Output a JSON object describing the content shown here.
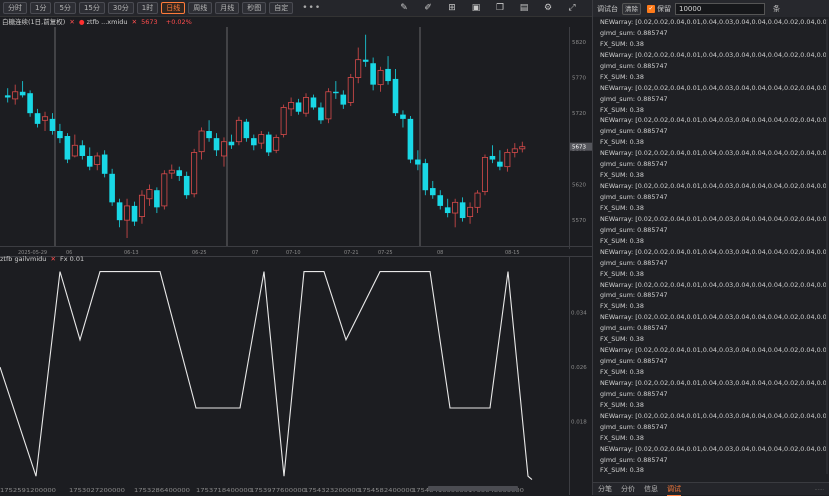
{
  "toolbar": {
    "periods": [
      "分时",
      "1分",
      "5分",
      "15分",
      "30分",
      "1时",
      "日线",
      "周线",
      "月线",
      "秒图",
      "自定"
    ],
    "active_period": "日线",
    "more": "•••",
    "tools": [
      "pencil-icon",
      "edit-icon",
      "layout-icon",
      "window-icon",
      "copy-icon",
      "save-icon",
      "settings-icon",
      "expand-icon"
    ]
  },
  "chart": {
    "legend_name": "白糖连续(1日,前复权)",
    "legend_indicator": "ztfb",
    "legend_source": "...xmidu",
    "legend_value": "5673",
    "legend_change": "+0.02%",
    "sub_title": "ztfb gailvmidu",
    "sub_indicator": "Fx 0.01",
    "price_ticks": [
      "5820",
      "5770",
      "5720",
      "5670",
      "5620",
      "5570"
    ],
    "current_price": "5673",
    "date_ticks": [
      "2025-05-29",
      "06",
      "06-13",
      "06-25",
      "07",
      "07-10",
      "07-21",
      "07-25",
      "08",
      "08-15"
    ],
    "indicator_ticks": [
      "0.034",
      "0.026",
      "0.018"
    ],
    "bottom_ticks": [
      "1752591200000",
      "1753027200000",
      "1753286400000",
      "1753718400000",
      "1753977600000",
      "1754323200000",
      "1754582400000",
      "1754841600000",
      "1755048000000"
    ],
    "up_color": "#d94b4b",
    "down_color": "#19d8e6"
  },
  "chart_data": {
    "type": "candlestick",
    "ylim": [
      5538,
      5838
    ],
    "candles": [
      {
        "o": 5745,
        "h": 5755,
        "l": 5735,
        "c": 5742
      },
      {
        "o": 5740,
        "h": 5760,
        "l": 5732,
        "c": 5750
      },
      {
        "o": 5750,
        "h": 5765,
        "l": 5742,
        "c": 5745
      },
      {
        "o": 5748,
        "h": 5752,
        "l": 5715,
        "c": 5720
      },
      {
        "o": 5720,
        "h": 5726,
        "l": 5700,
        "c": 5705
      },
      {
        "o": 5710,
        "h": 5722,
        "l": 5695,
        "c": 5715
      },
      {
        "o": 5712,
        "h": 5720,
        "l": 5690,
        "c": 5695
      },
      {
        "o": 5695,
        "h": 5705,
        "l": 5678,
        "c": 5685
      },
      {
        "o": 5688,
        "h": 5692,
        "l": 5650,
        "c": 5655
      },
      {
        "o": 5660,
        "h": 5690,
        "l": 5658,
        "c": 5675
      },
      {
        "o": 5675,
        "h": 5682,
        "l": 5655,
        "c": 5660
      },
      {
        "o": 5660,
        "h": 5672,
        "l": 5640,
        "c": 5645
      },
      {
        "o": 5648,
        "h": 5665,
        "l": 5640,
        "c": 5660
      },
      {
        "o": 5662,
        "h": 5668,
        "l": 5630,
        "c": 5635
      },
      {
        "o": 5635,
        "h": 5642,
        "l": 5590,
        "c": 5595
      },
      {
        "o": 5595,
        "h": 5600,
        "l": 5560,
        "c": 5570
      },
      {
        "o": 5570,
        "h": 5600,
        "l": 5545,
        "c": 5590
      },
      {
        "o": 5590,
        "h": 5596,
        "l": 5562,
        "c": 5568
      },
      {
        "o": 5575,
        "h": 5612,
        "l": 5565,
        "c": 5605
      },
      {
        "o": 5600,
        "h": 5620,
        "l": 5590,
        "c": 5613
      },
      {
        "o": 5612,
        "h": 5616,
        "l": 5580,
        "c": 5588
      },
      {
        "o": 5590,
        "h": 5640,
        "l": 5585,
        "c": 5635
      },
      {
        "o": 5636,
        "h": 5648,
        "l": 5628,
        "c": 5640
      },
      {
        "o": 5640,
        "h": 5645,
        "l": 5625,
        "c": 5632
      },
      {
        "o": 5632,
        "h": 5638,
        "l": 5600,
        "c": 5605
      },
      {
        "o": 5607,
        "h": 5670,
        "l": 5602,
        "c": 5665
      },
      {
        "o": 5666,
        "h": 5700,
        "l": 5655,
        "c": 5695
      },
      {
        "o": 5695,
        "h": 5710,
        "l": 5680,
        "c": 5685
      },
      {
        "o": 5685,
        "h": 5692,
        "l": 5660,
        "c": 5668
      },
      {
        "o": 5660,
        "h": 5686,
        "l": 5645,
        "c": 5680
      },
      {
        "o": 5680,
        "h": 5690,
        "l": 5670,
        "c": 5675
      },
      {
        "o": 5680,
        "h": 5715,
        "l": 5675,
        "c": 5710
      },
      {
        "o": 5708,
        "h": 5712,
        "l": 5680,
        "c": 5685
      },
      {
        "o": 5685,
        "h": 5690,
        "l": 5668,
        "c": 5675
      },
      {
        "o": 5678,
        "h": 5695,
        "l": 5670,
        "c": 5690
      },
      {
        "o": 5690,
        "h": 5694,
        "l": 5660,
        "c": 5665
      },
      {
        "o": 5668,
        "h": 5690,
        "l": 5664,
        "c": 5686
      },
      {
        "o": 5690,
        "h": 5732,
        "l": 5686,
        "c": 5728
      },
      {
        "o": 5726,
        "h": 5742,
        "l": 5716,
        "c": 5735
      },
      {
        "o": 5735,
        "h": 5740,
        "l": 5718,
        "c": 5722
      },
      {
        "o": 5720,
        "h": 5748,
        "l": 5715,
        "c": 5742
      },
      {
        "o": 5742,
        "h": 5746,
        "l": 5725,
        "c": 5728
      },
      {
        "o": 5728,
        "h": 5735,
        "l": 5705,
        "c": 5710
      },
      {
        "o": 5712,
        "h": 5755,
        "l": 5706,
        "c": 5750
      },
      {
        "o": 5750,
        "h": 5765,
        "l": 5740,
        "c": 5748
      },
      {
        "o": 5746,
        "h": 5752,
        "l": 5726,
        "c": 5732
      },
      {
        "o": 5735,
        "h": 5775,
        "l": 5730,
        "c": 5770
      },
      {
        "o": 5770,
        "h": 5812,
        "l": 5762,
        "c": 5795
      },
      {
        "o": 5795,
        "h": 5830,
        "l": 5785,
        "c": 5792
      },
      {
        "o": 5790,
        "h": 5798,
        "l": 5752,
        "c": 5760
      },
      {
        "o": 5760,
        "h": 5785,
        "l": 5750,
        "c": 5780
      },
      {
        "o": 5782,
        "h": 5800,
        "l": 5760,
        "c": 5765
      },
      {
        "o": 5768,
        "h": 5782,
        "l": 5716,
        "c": 5720
      },
      {
        "o": 5718,
        "h": 5724,
        "l": 5700,
        "c": 5712
      },
      {
        "o": 5712,
        "h": 5716,
        "l": 5650,
        "c": 5655
      },
      {
        "o": 5655,
        "h": 5668,
        "l": 5640,
        "c": 5648
      },
      {
        "o": 5650,
        "h": 5656,
        "l": 5605,
        "c": 5612
      },
      {
        "o": 5615,
        "h": 5625,
        "l": 5600,
        "c": 5605
      },
      {
        "o": 5605,
        "h": 5612,
        "l": 5585,
        "c": 5590
      },
      {
        "o": 5588,
        "h": 5600,
        "l": 5574,
        "c": 5580
      },
      {
        "o": 5580,
        "h": 5600,
        "l": 5560,
        "c": 5595
      },
      {
        "o": 5595,
        "h": 5602,
        "l": 5568,
        "c": 5573
      },
      {
        "o": 5575,
        "h": 5595,
        "l": 5565,
        "c": 5588
      },
      {
        "o": 5588,
        "h": 5612,
        "l": 5580,
        "c": 5608
      },
      {
        "o": 5610,
        "h": 5662,
        "l": 5605,
        "c": 5658
      },
      {
        "o": 5660,
        "h": 5675,
        "l": 5650,
        "c": 5655
      },
      {
        "o": 5652,
        "h": 5668,
        "l": 5640,
        "c": 5645
      },
      {
        "o": 5645,
        "h": 5670,
        "l": 5638,
        "c": 5665
      },
      {
        "o": 5665,
        "h": 5678,
        "l": 5658,
        "c": 5670
      },
      {
        "o": 5670,
        "h": 5680,
        "l": 5665,
        "c": 5673
      }
    ],
    "indicator": {
      "ylim": [
        0.009,
        0.042
      ],
      "values": [
        0.026,
        0.01,
        0.04,
        0.03,
        0.04,
        0.04,
        0.04,
        0.02,
        0.02,
        0.02,
        0.04,
        0.01,
        0.04,
        0.04,
        0.03,
        0.04,
        0.04,
        0.04,
        0.02,
        0.02,
        0.04,
        0.01,
        0.0095
      ]
    }
  },
  "debug": {
    "title": "调试台",
    "clear_label": "清除",
    "keep_label": "保留",
    "count_value": "10000",
    "unit": "条",
    "log_pattern": [
      "NEWarray: [0.02,0.02,0.04,0.01,0.04,0.03,0.04,0.04,0.04,0.02,0.04,0.04]",
      "glmd_sum: 0.885747",
      "FX_SUM: 0.38"
    ],
    "log_start": 0,
    "log_lines": 42,
    "tabs": [
      "分笔",
      "分价",
      "信息",
      "调试"
    ],
    "active_tab": "调试",
    "corner_text": "......"
  }
}
